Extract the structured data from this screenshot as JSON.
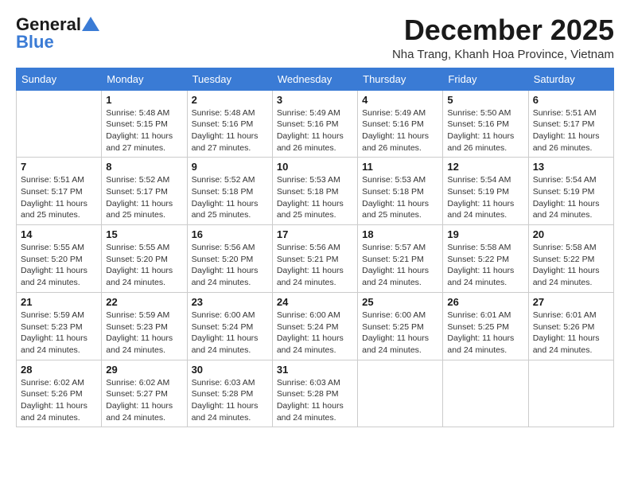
{
  "logo": {
    "general": "General",
    "blue": "Blue"
  },
  "title": "December 2025",
  "subtitle": "Nha Trang, Khanh Hoa Province, Vietnam",
  "days_of_week": [
    "Sunday",
    "Monday",
    "Tuesday",
    "Wednesday",
    "Thursday",
    "Friday",
    "Saturday"
  ],
  "weeks": [
    [
      {
        "day": "",
        "info": ""
      },
      {
        "day": "1",
        "info": "Sunrise: 5:48 AM\nSunset: 5:15 PM\nDaylight: 11 hours\nand 27 minutes."
      },
      {
        "day": "2",
        "info": "Sunrise: 5:48 AM\nSunset: 5:16 PM\nDaylight: 11 hours\nand 27 minutes."
      },
      {
        "day": "3",
        "info": "Sunrise: 5:49 AM\nSunset: 5:16 PM\nDaylight: 11 hours\nand 26 minutes."
      },
      {
        "day": "4",
        "info": "Sunrise: 5:49 AM\nSunset: 5:16 PM\nDaylight: 11 hours\nand 26 minutes."
      },
      {
        "day": "5",
        "info": "Sunrise: 5:50 AM\nSunset: 5:16 PM\nDaylight: 11 hours\nand 26 minutes."
      },
      {
        "day": "6",
        "info": "Sunrise: 5:51 AM\nSunset: 5:17 PM\nDaylight: 11 hours\nand 26 minutes."
      }
    ],
    [
      {
        "day": "7",
        "info": "Sunrise: 5:51 AM\nSunset: 5:17 PM\nDaylight: 11 hours\nand 25 minutes."
      },
      {
        "day": "8",
        "info": "Sunrise: 5:52 AM\nSunset: 5:17 PM\nDaylight: 11 hours\nand 25 minutes."
      },
      {
        "day": "9",
        "info": "Sunrise: 5:52 AM\nSunset: 5:18 PM\nDaylight: 11 hours\nand 25 minutes."
      },
      {
        "day": "10",
        "info": "Sunrise: 5:53 AM\nSunset: 5:18 PM\nDaylight: 11 hours\nand 25 minutes."
      },
      {
        "day": "11",
        "info": "Sunrise: 5:53 AM\nSunset: 5:18 PM\nDaylight: 11 hours\nand 25 minutes."
      },
      {
        "day": "12",
        "info": "Sunrise: 5:54 AM\nSunset: 5:19 PM\nDaylight: 11 hours\nand 24 minutes."
      },
      {
        "day": "13",
        "info": "Sunrise: 5:54 AM\nSunset: 5:19 PM\nDaylight: 11 hours\nand 24 minutes."
      }
    ],
    [
      {
        "day": "14",
        "info": "Sunrise: 5:55 AM\nSunset: 5:20 PM\nDaylight: 11 hours\nand 24 minutes."
      },
      {
        "day": "15",
        "info": "Sunrise: 5:55 AM\nSunset: 5:20 PM\nDaylight: 11 hours\nand 24 minutes."
      },
      {
        "day": "16",
        "info": "Sunrise: 5:56 AM\nSunset: 5:20 PM\nDaylight: 11 hours\nand 24 minutes."
      },
      {
        "day": "17",
        "info": "Sunrise: 5:56 AM\nSunset: 5:21 PM\nDaylight: 11 hours\nand 24 minutes."
      },
      {
        "day": "18",
        "info": "Sunrise: 5:57 AM\nSunset: 5:21 PM\nDaylight: 11 hours\nand 24 minutes."
      },
      {
        "day": "19",
        "info": "Sunrise: 5:58 AM\nSunset: 5:22 PM\nDaylight: 11 hours\nand 24 minutes."
      },
      {
        "day": "20",
        "info": "Sunrise: 5:58 AM\nSunset: 5:22 PM\nDaylight: 11 hours\nand 24 minutes."
      }
    ],
    [
      {
        "day": "21",
        "info": "Sunrise: 5:59 AM\nSunset: 5:23 PM\nDaylight: 11 hours\nand 24 minutes."
      },
      {
        "day": "22",
        "info": "Sunrise: 5:59 AM\nSunset: 5:23 PM\nDaylight: 11 hours\nand 24 minutes."
      },
      {
        "day": "23",
        "info": "Sunrise: 6:00 AM\nSunset: 5:24 PM\nDaylight: 11 hours\nand 24 minutes."
      },
      {
        "day": "24",
        "info": "Sunrise: 6:00 AM\nSunset: 5:24 PM\nDaylight: 11 hours\nand 24 minutes."
      },
      {
        "day": "25",
        "info": "Sunrise: 6:00 AM\nSunset: 5:25 PM\nDaylight: 11 hours\nand 24 minutes."
      },
      {
        "day": "26",
        "info": "Sunrise: 6:01 AM\nSunset: 5:25 PM\nDaylight: 11 hours\nand 24 minutes."
      },
      {
        "day": "27",
        "info": "Sunrise: 6:01 AM\nSunset: 5:26 PM\nDaylight: 11 hours\nand 24 minutes."
      }
    ],
    [
      {
        "day": "28",
        "info": "Sunrise: 6:02 AM\nSunset: 5:26 PM\nDaylight: 11 hours\nand 24 minutes."
      },
      {
        "day": "29",
        "info": "Sunrise: 6:02 AM\nSunset: 5:27 PM\nDaylight: 11 hours\nand 24 minutes."
      },
      {
        "day": "30",
        "info": "Sunrise: 6:03 AM\nSunset: 5:28 PM\nDaylight: 11 hours\nand 24 minutes."
      },
      {
        "day": "31",
        "info": "Sunrise: 6:03 AM\nSunset: 5:28 PM\nDaylight: 11 hours\nand 24 minutes."
      },
      {
        "day": "",
        "info": ""
      },
      {
        "day": "",
        "info": ""
      },
      {
        "day": "",
        "info": ""
      }
    ]
  ]
}
